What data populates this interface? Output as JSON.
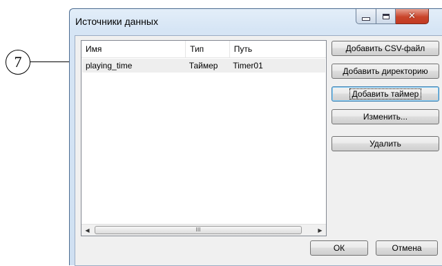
{
  "callout": {
    "number": "7"
  },
  "window": {
    "title": "Источники данных",
    "caption_icons": [
      "minimize-icon",
      "maximize-icon",
      "close-icon"
    ]
  },
  "list": {
    "columns": [
      "Имя",
      "Тип",
      "Путь"
    ],
    "rows": [
      {
        "name": "playing_time",
        "type": "Таймер",
        "path": "Timer01"
      }
    ]
  },
  "scrollbar": {
    "left_arrow": "◀",
    "right_arrow": "▶",
    "grip": "III"
  },
  "buttons": {
    "add_csv": "Добавить CSV-файл",
    "add_directory": "Добавить директорию",
    "add_timer": "Добавить таймер",
    "edit": "Изменить...",
    "delete": "Удалить",
    "ok": "ОК",
    "cancel": "Отмена"
  },
  "colors": {
    "title_bar": "#d6e5f5",
    "close_button": "#c9442a",
    "selected_row": "#eeeeee",
    "default_button_border": "#3c7fb1"
  }
}
